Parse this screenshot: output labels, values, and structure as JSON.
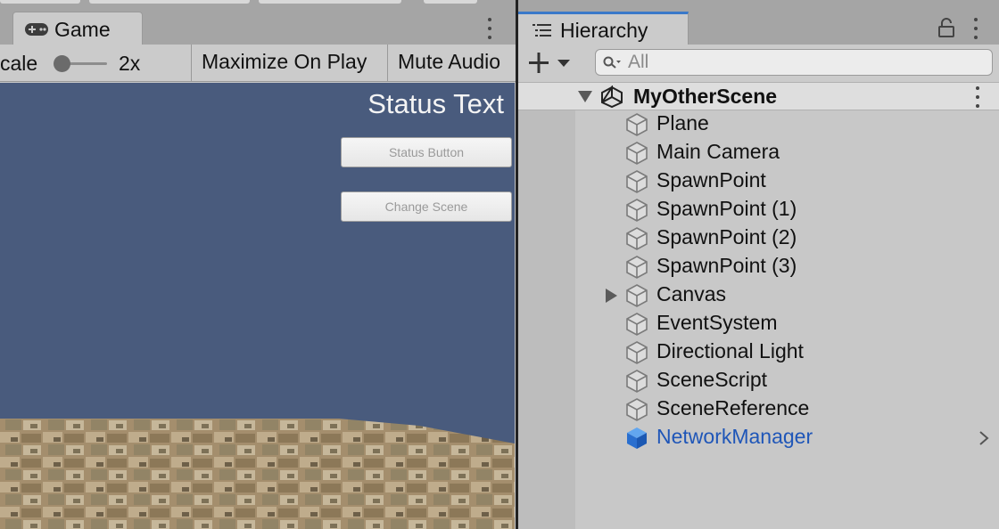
{
  "game": {
    "tab_label": "Game",
    "scale_label": "cale",
    "scale_value": "2x",
    "scale_slider_fraction": 0.0,
    "maximize_label": "Maximize On Play",
    "mute_label": "Mute Audio",
    "status_text": "Status Text",
    "status_button_label": "Status Button",
    "change_scene_button_label": "Change Scene",
    "sky_color": "#495b7d"
  },
  "hierarchy": {
    "tab_label": "Hierarchy",
    "accent_color": "#3a79c9",
    "search_placeholder": "All",
    "scene_name": "MyOtherScene",
    "items": [
      {
        "label": "Plane",
        "icon": "gameobject-icon",
        "prefab": false,
        "expandable": false
      },
      {
        "label": "Main Camera",
        "icon": "gameobject-icon",
        "prefab": false,
        "expandable": false
      },
      {
        "label": "SpawnPoint",
        "icon": "gameobject-icon",
        "prefab": false,
        "expandable": false
      },
      {
        "label": "SpawnPoint (1)",
        "icon": "gameobject-icon",
        "prefab": false,
        "expandable": false
      },
      {
        "label": "SpawnPoint (2)",
        "icon": "gameobject-icon",
        "prefab": false,
        "expandable": false
      },
      {
        "label": "SpawnPoint (3)",
        "icon": "gameobject-icon",
        "prefab": false,
        "expandable": false
      },
      {
        "label": "Canvas",
        "icon": "gameobject-icon",
        "prefab": false,
        "expandable": true
      },
      {
        "label": "EventSystem",
        "icon": "gameobject-icon",
        "prefab": false,
        "expandable": false
      },
      {
        "label": "Directional Light",
        "icon": "gameobject-icon",
        "prefab": false,
        "expandable": false
      },
      {
        "label": "SceneScript",
        "icon": "gameobject-icon",
        "prefab": false,
        "expandable": false
      },
      {
        "label": "SceneReference",
        "icon": "gameobject-icon",
        "prefab": false,
        "expandable": false
      },
      {
        "label": "NetworkManager",
        "icon": "prefab-icon",
        "prefab": true,
        "expandable": false
      }
    ],
    "prefab_color": "#1f56b8"
  }
}
